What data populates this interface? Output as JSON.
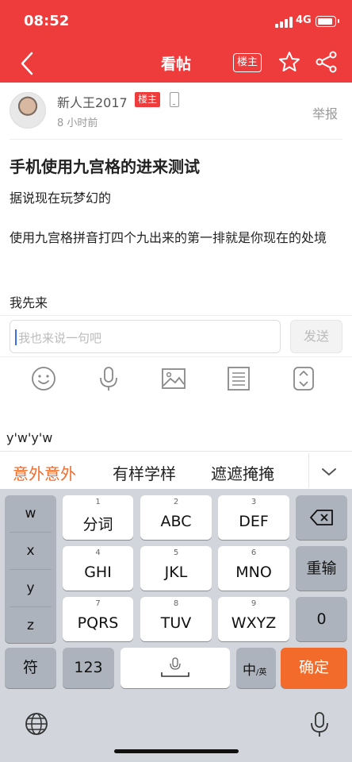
{
  "status_bar": {
    "time": "08:52",
    "network": "4G",
    "battery_level": 0.9
  },
  "nav": {
    "title": "看帖",
    "op_label": "楼主"
  },
  "post": {
    "author": "新人王2017",
    "badge": "楼主",
    "time_ago": "8 小时前",
    "report": "举报",
    "title": "手机使用九宫格的进来测试",
    "paragraphs": [
      "据说现在玩梦幻的",
      "使用九宫格拼音打四个九出来的第一排就是你现在的处境",
      "我先来"
    ]
  },
  "reply": {
    "placeholder": "我也来说一句吧",
    "send_label": "发送"
  },
  "toolbar": {
    "icons": [
      "smiley-icon",
      "microphone-icon",
      "image-icon",
      "list-icon",
      "expand-icon"
    ]
  },
  "ime": {
    "input_echo": "y'w'y'w",
    "candidates": [
      "意外意外",
      "有样学样",
      "遮遮掩掩"
    ],
    "side_keys": [
      "w",
      "x",
      "y",
      "z"
    ],
    "keys": [
      {
        "num": "1",
        "label": "分词"
      },
      {
        "num": "2",
        "label": "ABC"
      },
      {
        "num": "3",
        "label": "DEF"
      },
      {
        "num": "4",
        "label": "GHI"
      },
      {
        "num": "5",
        "label": "JKL"
      },
      {
        "num": "6",
        "label": "MNO"
      },
      {
        "num": "7",
        "label": "PQRS"
      },
      {
        "num": "8",
        "label": "TUV"
      },
      {
        "num": "9",
        "label": "WXYZ"
      }
    ],
    "retype": "重输",
    "zero": "0",
    "symbol": "符",
    "num_switch": "123",
    "lang_switch_main": "中",
    "lang_switch_sub": "/英",
    "confirm": "确定"
  },
  "colors": {
    "brand": "#ee3b3b",
    "accent": "#f26b2b",
    "keyboard_bg": "#d2d5db"
  }
}
